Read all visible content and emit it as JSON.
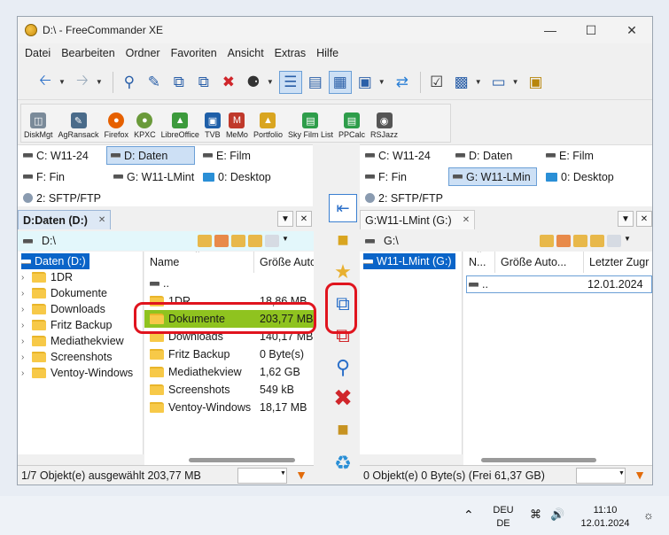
{
  "window": {
    "title": "D:\\ - FreeCommander XE"
  },
  "menu": [
    "Datei",
    "Bearbeiten",
    "Ordner",
    "Favoriten",
    "Ansicht",
    "Extras",
    "Hilfe"
  ],
  "tools": [
    {
      "label": "DiskMgt",
      "color": "#7a8a99"
    },
    {
      "label": "AgRansack",
      "color": "#4a6b8a"
    },
    {
      "label": "Firefox",
      "color": "#e66000"
    },
    {
      "label": "KPXC",
      "color": "#6a9a3a"
    },
    {
      "label": "LibreOffice",
      "color": "#3c9a3c"
    },
    {
      "label": "TVB",
      "color": "#1f5fa8"
    },
    {
      "label": "MeMo",
      "color": "#c0392b"
    },
    {
      "label": "Portfolio",
      "color": "#d9a520"
    },
    {
      "label": "Sky Film List",
      "color": "#2e9d4a"
    },
    {
      "label": "PPCalc",
      "color": "#2e9d4a"
    },
    {
      "label": "RSJazz",
      "color": "#555555"
    }
  ],
  "left": {
    "drives": [
      "C: W11-24",
      "D: Daten",
      "E: Film",
      "F: Fin",
      "G: W11-LMint",
      "0: Desktop",
      "2: SFTP/FTP"
    ],
    "tab": "D:Daten (D:)",
    "path": "D:\\",
    "tree": {
      "root": "Daten (D:)",
      "items": [
        "1DR",
        "Dokumente",
        "Downloads",
        "Fritz Backup",
        "Mediathekview",
        "Screenshots",
        "Ventoy-Windows"
      ]
    },
    "columns": [
      "Name",
      "Größe Auto"
    ],
    "rows": [
      {
        "name": "..",
        "size": ""
      },
      {
        "name": "1DR",
        "size": "18,86 MB"
      },
      {
        "name": "Dokumente",
        "size": "203,77 MB"
      },
      {
        "name": "Downloads",
        "size": "140,17 MB"
      },
      {
        "name": "Fritz Backup",
        "size": "0 Byte(s)"
      },
      {
        "name": "Mediathekview",
        "size": "1,62 GB"
      },
      {
        "name": "Screenshots",
        "size": "549 kB"
      },
      {
        "name": "Ventoy-Windows",
        "size": "18,17 MB"
      }
    ],
    "status": "1/7 Objekt(e) ausgewählt  203,77 MB"
  },
  "right": {
    "drives": [
      "C: W11-24",
      "D: Daten",
      "E: Film",
      "F: Fin",
      "G: W11-LMin",
      "0: Desktop",
      "2: SFTP/FTP"
    ],
    "tab": "G:W11-LMint (G:)",
    "path": "G:\\",
    "tree": {
      "root": "W11-LMint (G:)"
    },
    "columns": [
      "N...",
      "Größe Auto...",
      "Letzter Zugr"
    ],
    "rows": [
      {
        "name": "..",
        "size": "",
        "date": "12.01.2024"
      }
    ],
    "status": "0 Objekt(e)  0 Byte(s)   (Frei 61,37 GB)"
  },
  "taskbar": {
    "lang1": "DEU",
    "lang2": "DE",
    "time": "11:10",
    "date": "12.01.2024"
  }
}
